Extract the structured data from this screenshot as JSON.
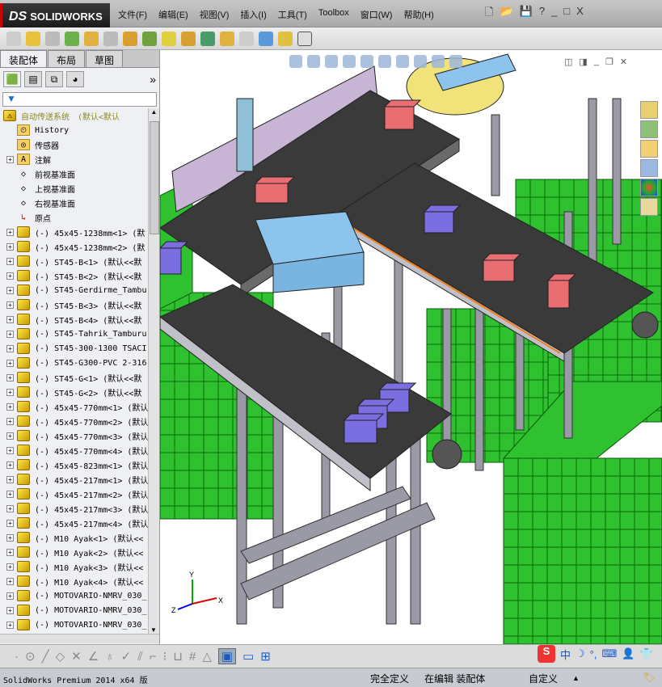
{
  "app": {
    "logo": "SOLIDWORKS",
    "logo_prefix": "DS"
  },
  "menu": [
    "文件(F)",
    "编辑(E)",
    "视图(V)",
    "插入(I)",
    "工具(T)",
    "Toolbox",
    "窗口(W)",
    "帮助(H)"
  ],
  "window_controls": {
    "help": "?",
    "minimize": "_",
    "restore": "□",
    "close": "X"
  },
  "left_panel": {
    "tabs": [
      {
        "label": "装配体",
        "active": true
      },
      {
        "label": "布局",
        "active": false
      },
      {
        "label": "草图",
        "active": false
      }
    ],
    "more": "»",
    "filter_icon": "funnel-icon",
    "tree": [
      {
        "label": "自动传送系统",
        "suffix": "(默认<默认",
        "type": "assembly",
        "expandable": false
      },
      {
        "label": "History",
        "type": "history",
        "expandable": false
      },
      {
        "label": "传感器",
        "type": "sensor",
        "expandable": false
      },
      {
        "label": "注解",
        "type": "annotation",
        "expandable": true
      },
      {
        "label": "前视基准面",
        "type": "plane",
        "expandable": false
      },
      {
        "label": "上视基准面",
        "type": "plane",
        "expandable": false
      },
      {
        "label": "右视基准面",
        "type": "plane",
        "expandable": false
      },
      {
        "label": "原点",
        "type": "origin",
        "expandable": false
      },
      {
        "label": "(-) 45x45-1238mm<1> (默",
        "type": "component",
        "expandable": true
      },
      {
        "label": "(-) 45x45-1238mm<2> (默",
        "type": "component",
        "expandable": true
      },
      {
        "label": "(-) ST45-B<1> (默认<<默",
        "type": "component",
        "expandable": true
      },
      {
        "label": "(-) ST45-B<2> (默认<<默",
        "type": "component",
        "expandable": true
      },
      {
        "label": "(-) ST45-Gerdirme_Tambu",
        "type": "component",
        "expandable": true
      },
      {
        "label": "(-) ST45-B<3> (默认<<默",
        "type": "component",
        "expandable": true
      },
      {
        "label": "(-) ST45-B<4> (默认<<默",
        "type": "component",
        "expandable": true
      },
      {
        "label": "(-) ST45-Tahrik_Tamburu",
        "type": "component",
        "expandable": true
      },
      {
        "label": "(-) ST45-300-1300 TSACI",
        "type": "component",
        "expandable": true
      },
      {
        "label": "(-) ST45-G300-PVC 2-316",
        "type": "component",
        "expandable": true
      },
      {
        "label": "(-) ST45-G<1> (默认<<默",
        "type": "component",
        "expandable": true
      },
      {
        "label": "(-) ST45-G<2> (默认<<默",
        "type": "component",
        "expandable": true
      },
      {
        "label": "(-) 45x45-770mm<1> (默认",
        "type": "component",
        "expandable": true
      },
      {
        "label": "(-) 45x45-770mm<2> (默认",
        "type": "component",
        "expandable": true
      },
      {
        "label": "(-) 45x45-770mm<3> (默认",
        "type": "component",
        "expandable": true
      },
      {
        "label": "(-) 45x45-770mm<4> (默认",
        "type": "component",
        "expandable": true
      },
      {
        "label": "(-) 45x45-823mm<1> (默认",
        "type": "component",
        "expandable": true
      },
      {
        "label": "(-) 45x45-217mm<1> (默认",
        "type": "component",
        "expandable": true
      },
      {
        "label": "(-) 45x45-217mm<2> (默认",
        "type": "component",
        "expandable": true
      },
      {
        "label": "(-) 45x45-217mm<3> (默认",
        "type": "component",
        "expandable": true
      },
      {
        "label": "(-) 45x45-217mm<4> (默认",
        "type": "component",
        "expandable": true
      },
      {
        "label": "(-) M10 Ayak<1> (默认<<",
        "type": "component",
        "expandable": true
      },
      {
        "label": "(-) M10 Ayak<2> (默认<<",
        "type": "component",
        "expandable": true
      },
      {
        "label": "(-) M10 Ayak<3> (默认<<",
        "type": "component",
        "expandable": true
      },
      {
        "label": "(-) M10 Ayak<4> (默认<<",
        "type": "component",
        "expandable": true
      },
      {
        "label": "(-) MOTOVARIO-NMRV_030_",
        "type": "component",
        "expandable": true
      },
      {
        "label": "(-) MOTOVARIO-NMRV_030_",
        "type": "component",
        "expandable": true
      },
      {
        "label": "(-) MOTOVARIO-NMRV_030_",
        "type": "component",
        "expandable": true
      }
    ]
  },
  "viewport": {
    "triad_labels": {
      "x": "X",
      "y": "Y",
      "z": "Z"
    }
  },
  "ime": {
    "logo": "S",
    "mode": "中",
    "punct": "°,"
  },
  "status": {
    "version": "SolidWorks Premium 2014 x64 版",
    "state": "完全定义",
    "editing": "在编辑 装配体",
    "units": "自定义",
    "units_arrow": "▲"
  },
  "colors": {
    "crate": "#2fc12f",
    "belt": "#3a3a3a",
    "frame": "#9a9aa6",
    "box_red": "#e86e72",
    "box_purple": "#7b6ee0",
    "sensor": "#8cc4ee",
    "turntable": "#f2e27a"
  }
}
